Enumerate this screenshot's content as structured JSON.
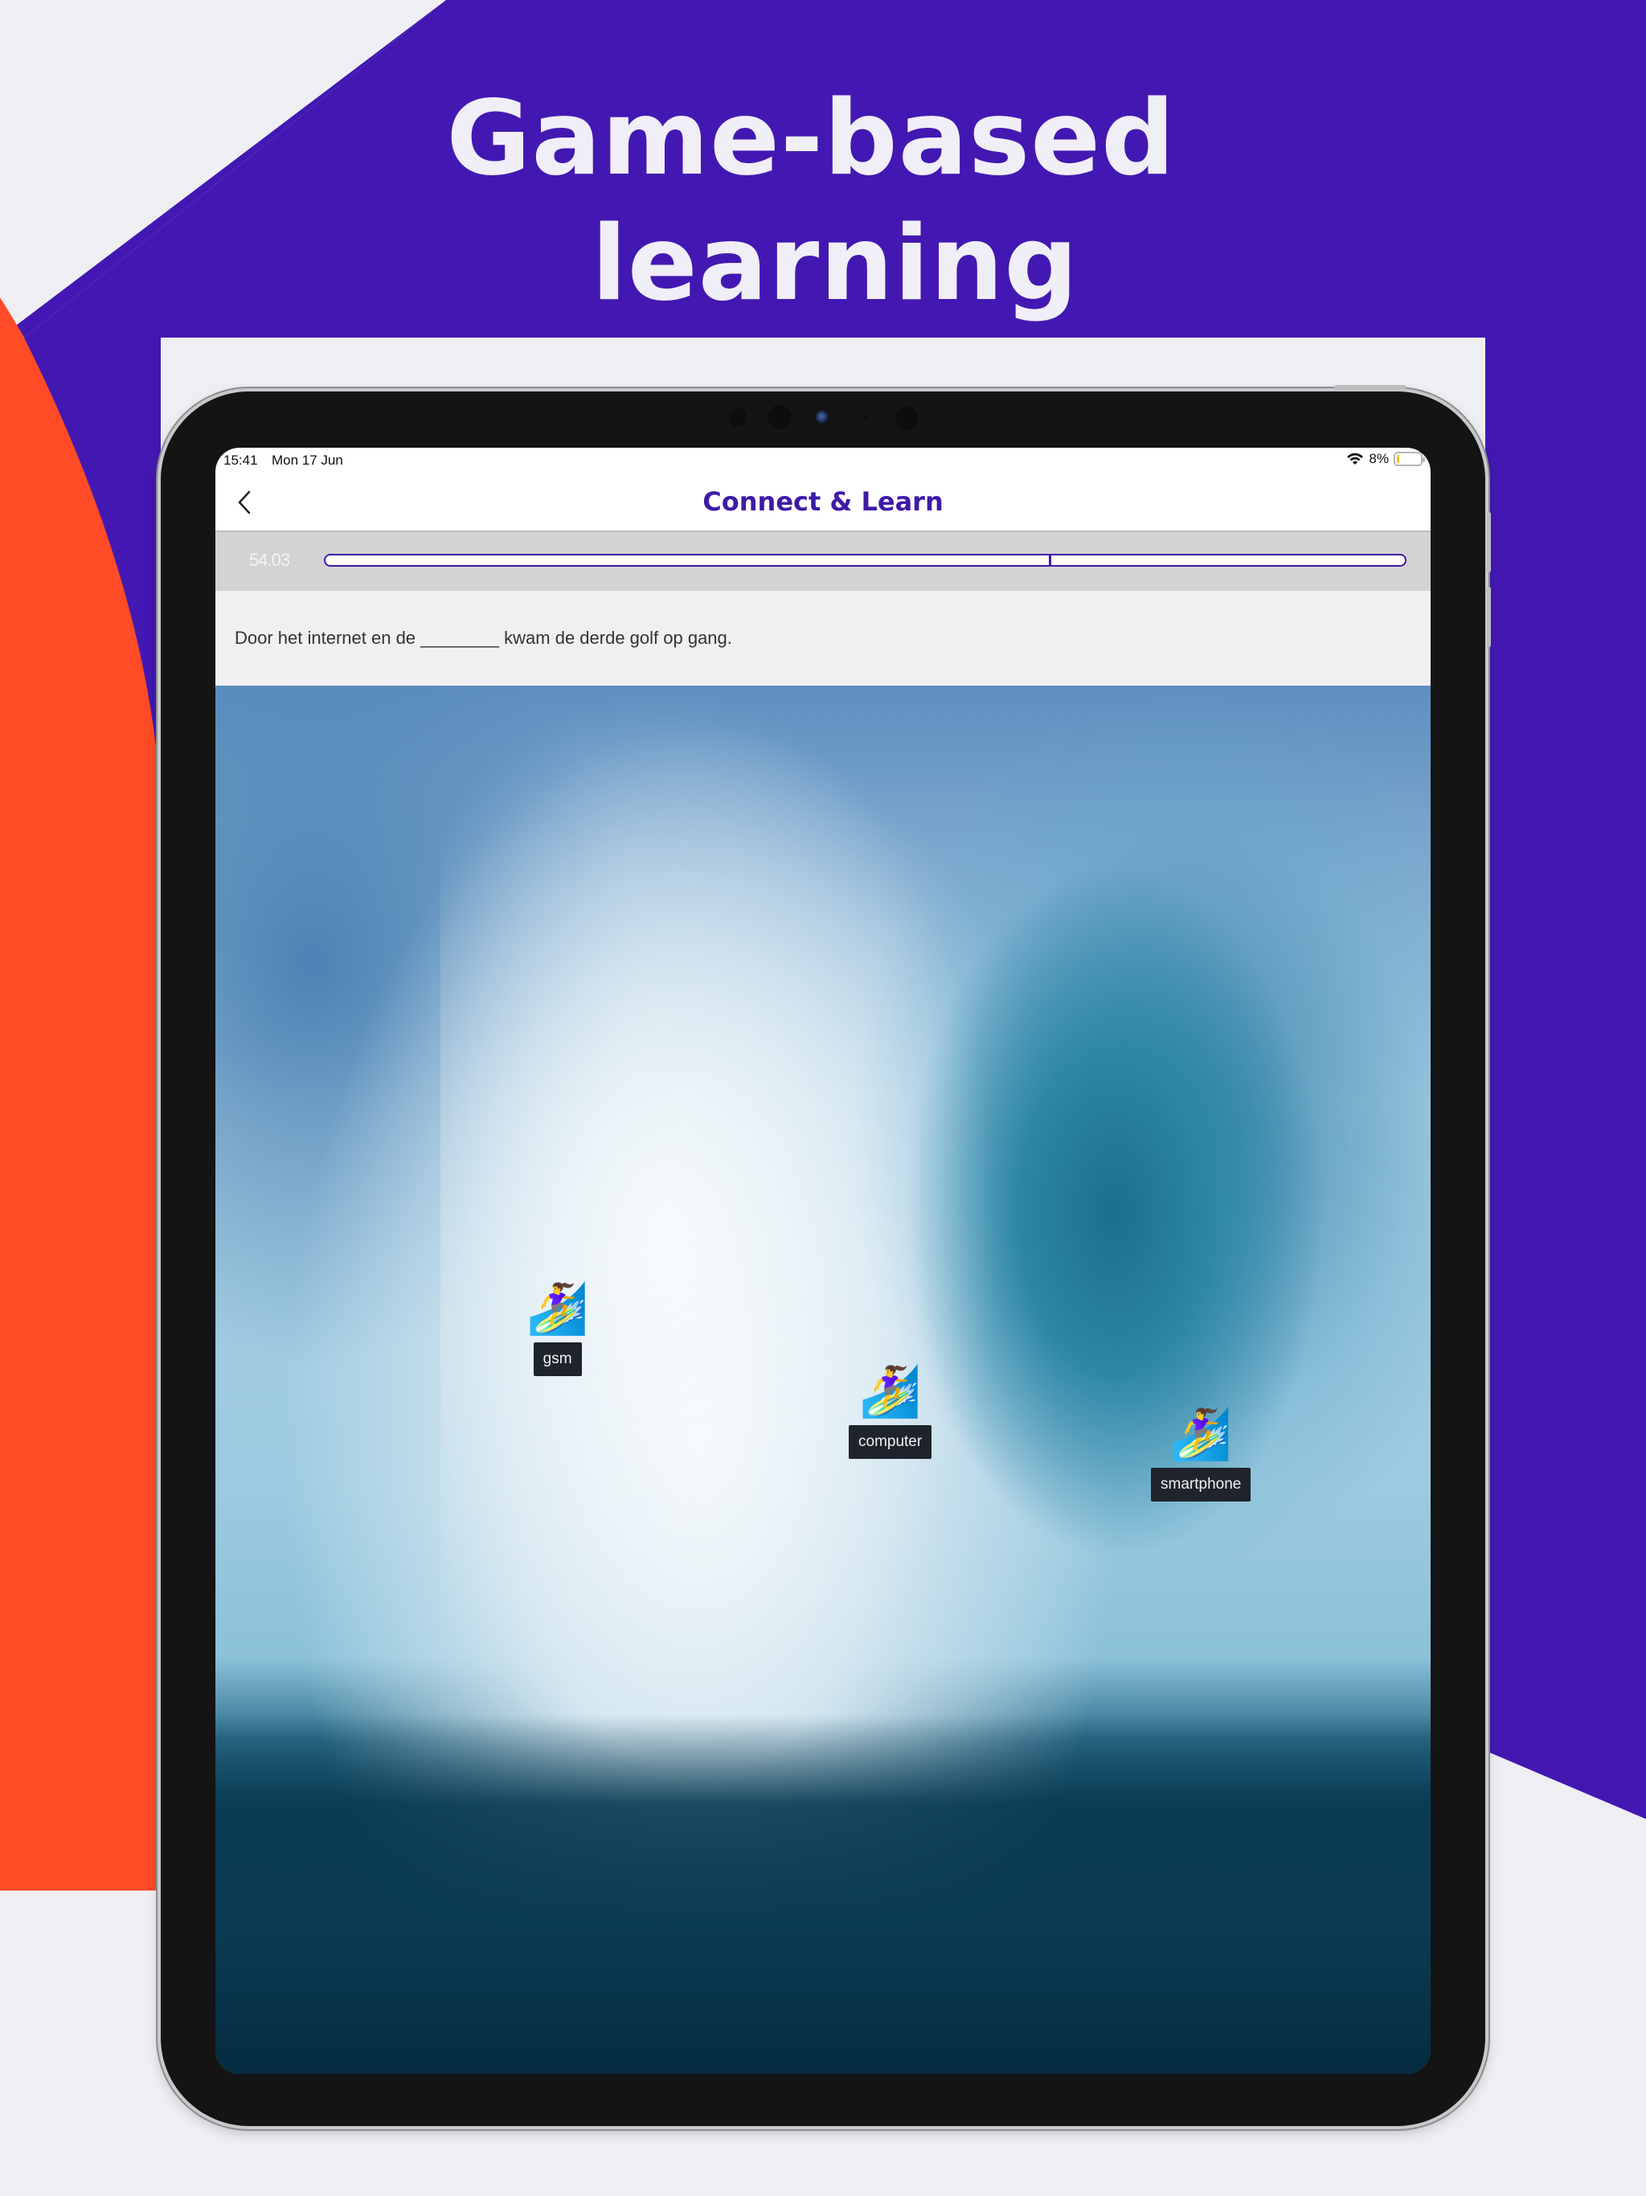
{
  "marketing": {
    "headline_line1": "Game-based",
    "headline_line2": "learning",
    "colors": {
      "purple": "#4318b2",
      "orange": "#ff4c27",
      "light_bg": "#efeef3"
    }
  },
  "status_bar": {
    "time": "15:41",
    "date": "Mon 17 Jun",
    "battery_text": "8%",
    "battery_level": 0.08,
    "wifi_icon": "wifi-icon",
    "battery_icon": "battery-icon"
  },
  "nav": {
    "back_icon": "chevron-left-icon",
    "title": "Connect & Learn",
    "title_color": "#3f1aa8"
  },
  "game": {
    "timer": "54.03",
    "progress": 0.67,
    "question": "Door het internet en de ________ kwam de derde golf op gang.",
    "answers": [
      {
        "emoji": "🏄‍♀️",
        "label": "gsm"
      },
      {
        "emoji": "🏄‍♀️",
        "label": "computer"
      },
      {
        "emoji": "🏄‍♀️",
        "label": "smartphone"
      }
    ]
  }
}
